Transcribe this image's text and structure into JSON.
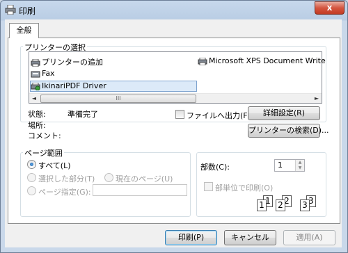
{
  "window": {
    "title": "印刷",
    "close_glyph": "x",
    "colors": {
      "titlebar": "#b9cde4",
      "close": "#c23a23",
      "accent": "#3c7fb1"
    }
  },
  "tabs": [
    {
      "label": "全般",
      "selected": true
    }
  ],
  "printer_select": {
    "group_label": "プリンターの選択",
    "items": [
      {
        "label": "プリンターの追加",
        "icon": "printer-add-icon"
      },
      {
        "label": "Microsoft XPS Document Write",
        "icon": "printer-icon"
      },
      {
        "label": "Fax",
        "icon": "fax-icon"
      },
      {
        "label": "IkinariPDF Driver",
        "icon": "printer-default-icon",
        "selected": true
      }
    ],
    "scroll_left": "◄",
    "scroll_right": "►",
    "scroll_grip": "III"
  },
  "status": {
    "state_label": "状態:",
    "state_value": "準備完了",
    "location_label": "場所:",
    "comment_label": "コメント:",
    "print_to_file_label": "ファイルへ出力(F)",
    "print_to_file_checked": false,
    "preferences_button": "詳細設定(R)",
    "find_printer_button": "プリンターの検索(D)..."
  },
  "page_range": {
    "group_label": "ページ範囲",
    "all_label": "すべて(L)",
    "all_checked": true,
    "selection_label": "選択した部分(T)",
    "current_page_label": "現在のページ(U)",
    "pages_label": "ページ指定(G):",
    "pages_value": ""
  },
  "copies": {
    "count_label": "部数(C):",
    "count_value": "1",
    "collate_label": "部単位で印刷(O)",
    "collate_checked": false,
    "pages_preview": [
      "1",
      "1",
      "2",
      "2",
      "3",
      "3"
    ]
  },
  "buttons": {
    "print": "印刷(P)",
    "cancel": "キャンセル",
    "apply": "適用(A)"
  }
}
